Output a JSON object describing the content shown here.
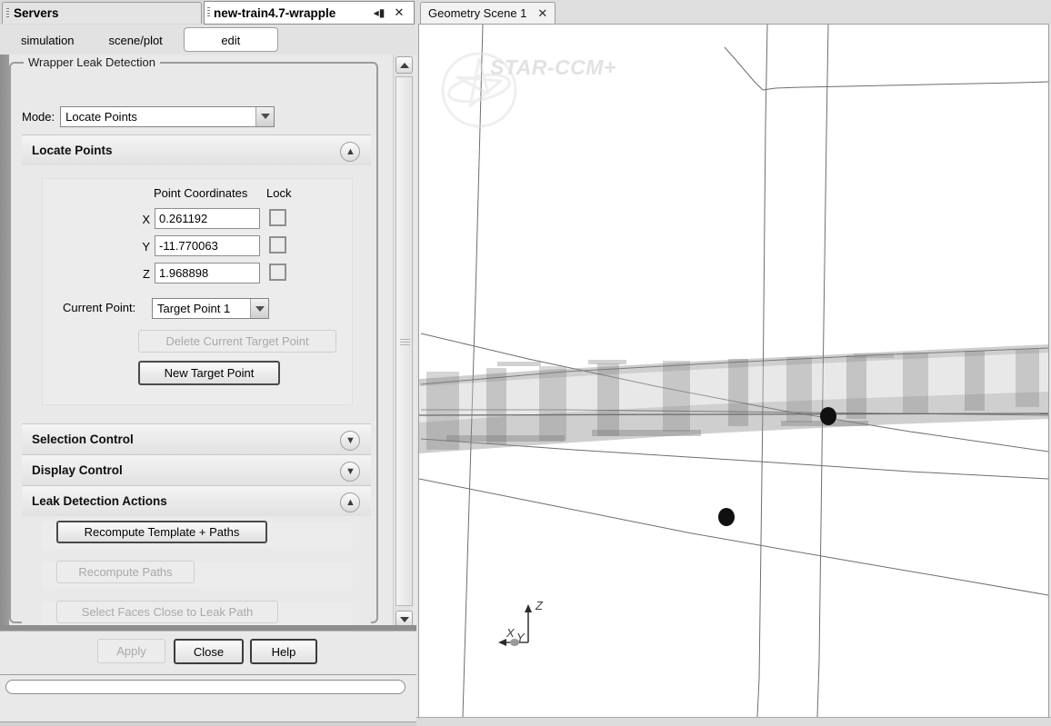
{
  "window": {
    "servers_tab_label": "Servers",
    "title": "new-train4.7-wrapple",
    "minimize_icon": "collapse-icon",
    "close_icon": "close-icon"
  },
  "toolbar_tabs": [
    {
      "label": "simulation",
      "selected": false
    },
    {
      "label": "scene/plot",
      "selected": false
    },
    {
      "label": "edit",
      "selected": true
    }
  ],
  "panel": {
    "group_title": "Wrapper Leak Detection",
    "mode": {
      "label": "Mode:",
      "value": "Locate Points"
    },
    "sections": {
      "locate_points": {
        "title": "Locate Points",
        "expanded": true,
        "toggle_icon": "chevron-double-up-icon",
        "headers": {
          "coordinates": "Point Coordinates",
          "lock": "Lock"
        },
        "coordinates": [
          {
            "axis": "X",
            "value": "0.261192",
            "locked": false
          },
          {
            "axis": "Y",
            "value": "-11.770063",
            "locked": false
          },
          {
            "axis": "Z",
            "value": "1.968898",
            "locked": false
          }
        ],
        "current_point": {
          "label": "Current Point:",
          "value": "Target Point 1"
        },
        "delete_button": {
          "label": "Delete Current Target Point",
          "enabled": false
        },
        "new_button": {
          "label": "New Target Point",
          "enabled": true,
          "default": true
        }
      },
      "selection_control": {
        "title": "Selection Control",
        "expanded": false,
        "toggle_icon": "chevron-double-down-icon"
      },
      "display_control": {
        "title": "Display Control",
        "expanded": false,
        "toggle_icon": "chevron-double-down-icon"
      },
      "leak_detection_actions": {
        "title": "Leak Detection Actions",
        "expanded": true,
        "toggle_icon": "chevron-double-up-icon",
        "buttons": [
          {
            "label": "Recompute Template + Paths",
            "enabled": true,
            "default": true
          },
          {
            "label": "Recompute Paths",
            "enabled": false,
            "default": false
          },
          {
            "label": "Select Faces Close to Leak Path",
            "enabled": false,
            "default": false
          }
        ]
      }
    },
    "dialog_buttons": [
      {
        "label": "Apply",
        "enabled": false
      },
      {
        "label": "Close",
        "enabled": true
      },
      {
        "label": "Help",
        "enabled": true
      }
    ],
    "status_field_value": ""
  },
  "scrollbar": {
    "up_icon": "chevron-up-icon",
    "down_icon": "chevron-down-icon"
  },
  "scene": {
    "tab_label": "Geometry Scene 1",
    "tab_close_icon": "close-icon",
    "watermark_text": "STAR-CCM+",
    "watermark_logo_icon": "star-ccm-logo-icon",
    "axis_triad": {
      "x_label": "X",
      "y_label": "Y",
      "z_label": "Z"
    },
    "point_markers": [
      {
        "name": "target-point-marker-1"
      },
      {
        "name": "target-point-marker-2"
      }
    ]
  },
  "colors": {
    "panel_bg": "#e9e9e9",
    "titlebar_bg": "#d9d9d9",
    "selected_tab_bg": "#ffffff",
    "scene_bg": "#ffffff",
    "geometry_fill": "#b8b8b8",
    "marker": "#111111",
    "border": "#8f8f8f"
  }
}
